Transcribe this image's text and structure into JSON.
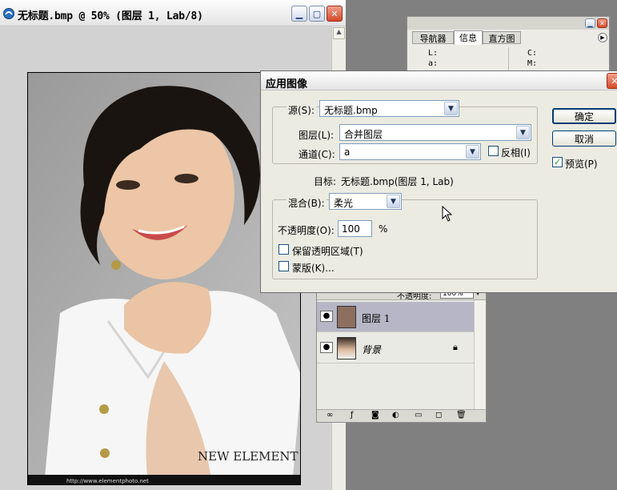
{
  "document": {
    "title": "无标题.bmp @ 50% (图层 1, Lab/8)",
    "watermark_brand": "NEW ELEMENT",
    "footer_url": "http://www.elementphoto.net"
  },
  "info_panel": {
    "tabs": [
      "导航器",
      "信息",
      "直方图"
    ],
    "readouts": [
      "L:",
      "a:",
      "C:",
      "M:"
    ]
  },
  "layers_panel": {
    "opacity_label": "不透明度:",
    "opacity_value": "100%",
    "layers": [
      {
        "name": "图层 1",
        "selected": true
      },
      {
        "name": "背景",
        "locked": true
      }
    ]
  },
  "dialog": {
    "title": "应用图像",
    "source_label": "源(S):",
    "source_value": "无标题.bmp",
    "layer_label": "图层(L):",
    "layer_value": "合并图层",
    "channel_label": "通道(C):",
    "channel_value": "a",
    "invert_label": "反相(I)",
    "target_label": "目标:",
    "target_value": "无标题.bmp(图层 1, Lab)",
    "blending_label": "混合(B):",
    "blending_value": "柔光",
    "opacity_label": "不透明度(O):",
    "opacity_value": "100",
    "percent": "%",
    "preserve_label": "保留透明区域(T)",
    "mask_label": "蒙版(K)...",
    "ok_label": "确定",
    "cancel_label": "取消",
    "preview_label": "预览(P)",
    "preview_checked": true
  }
}
